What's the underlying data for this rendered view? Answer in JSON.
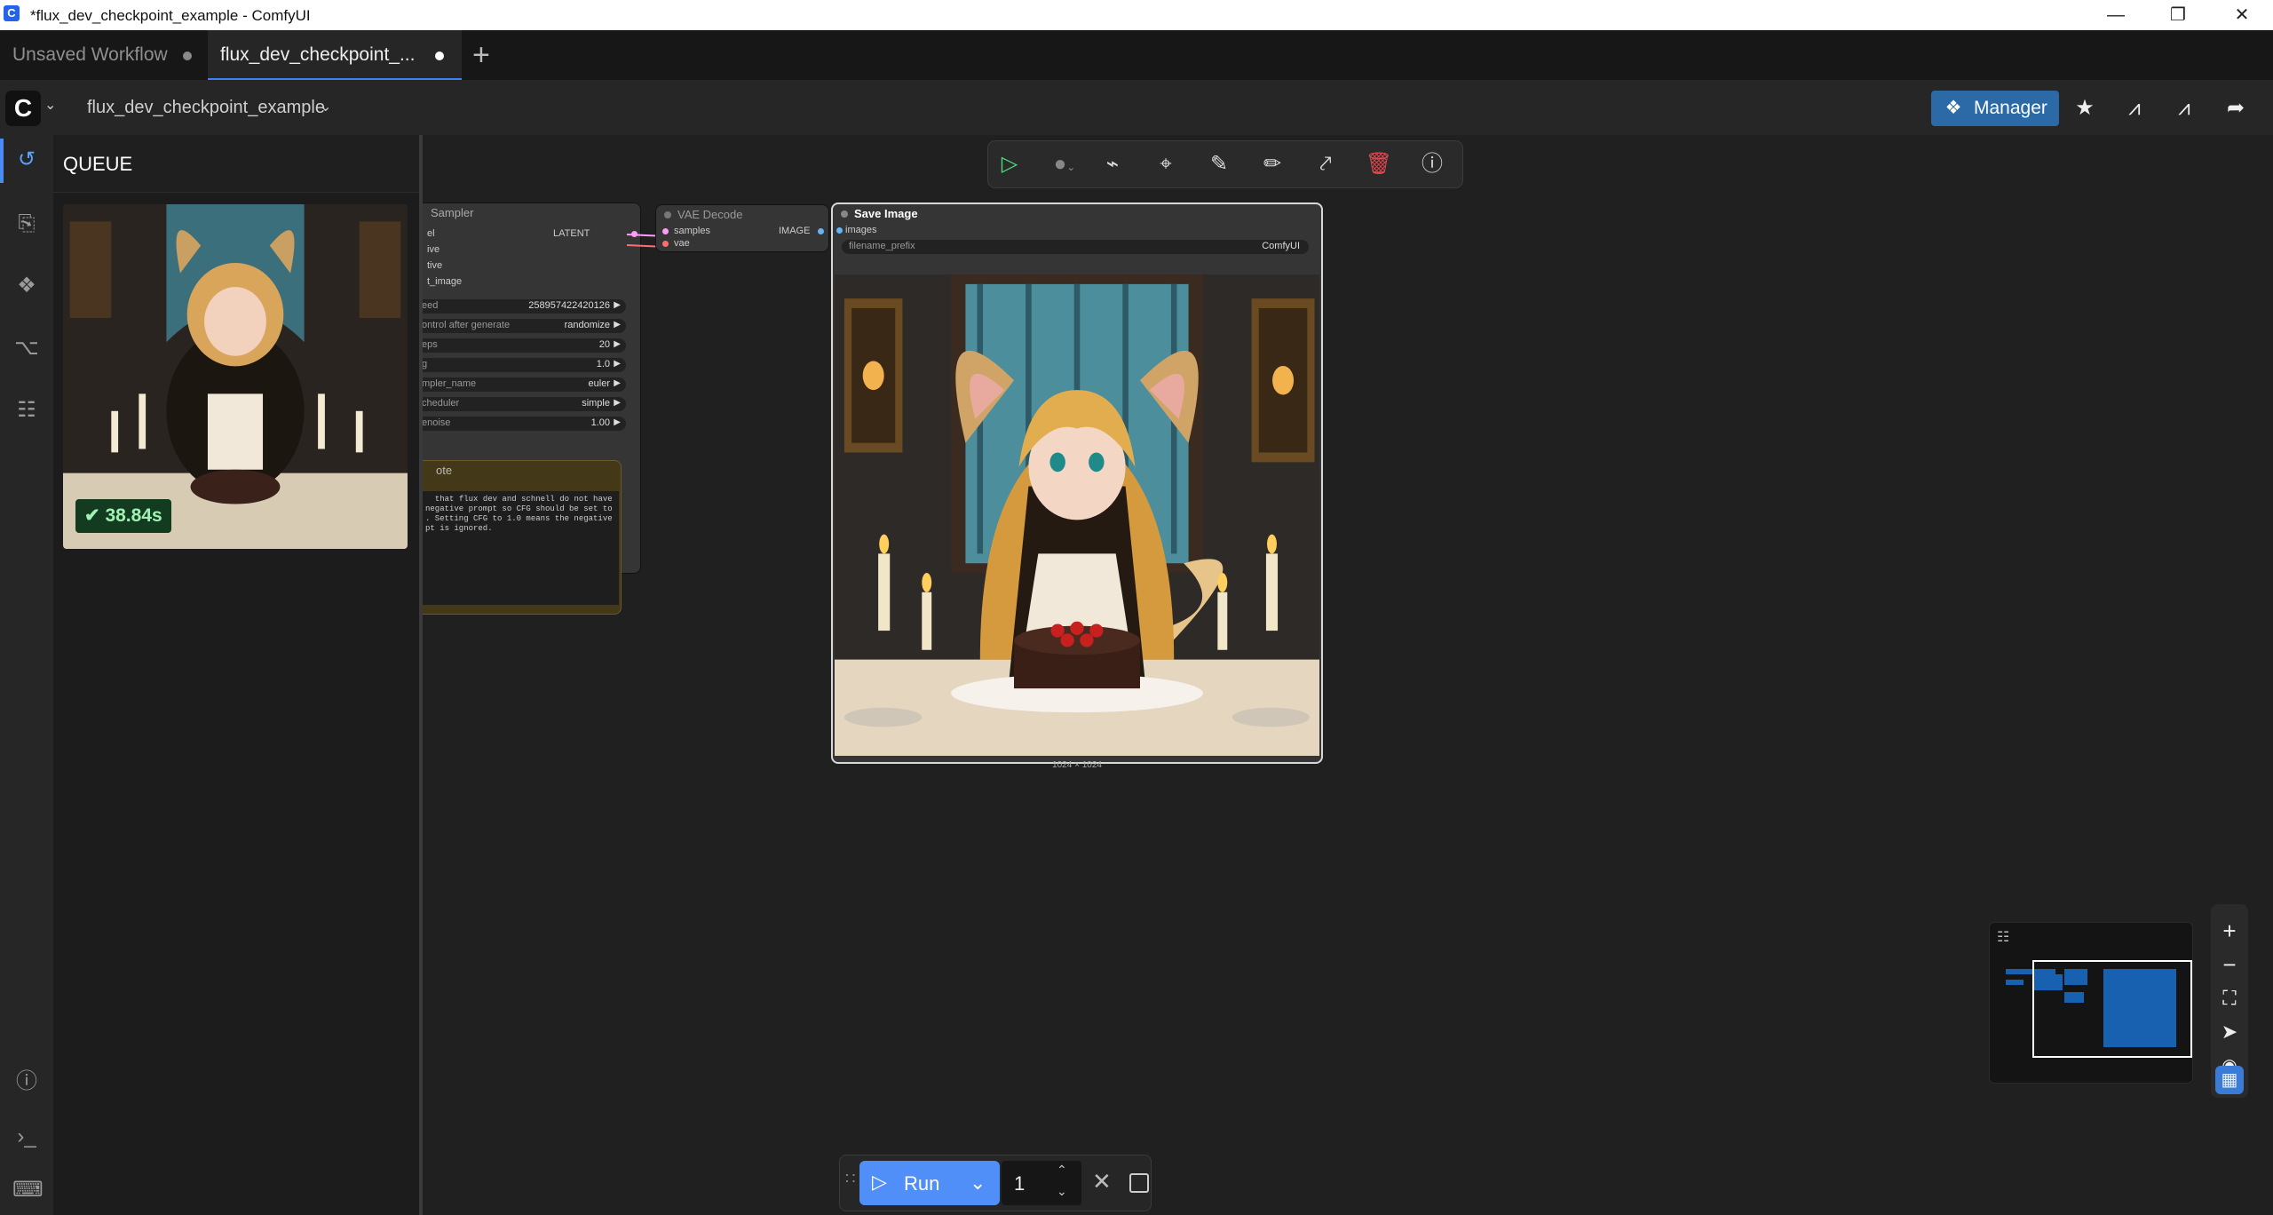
{
  "window": {
    "title": "*flux_dev_checkpoint_example - ComfyUI",
    "app_icon": "C",
    "controls": [
      "minimize-icon",
      "restore-icon",
      "close-icon"
    ]
  },
  "tabs": [
    {
      "label": "Unsaved Workflow",
      "modified_dot": "•"
    },
    {
      "label": "flux_dev_checkpoint_...",
      "modified_dot": "•",
      "active": true
    }
  ],
  "new_tab_label": "+",
  "menubar": {
    "logo": "C",
    "workflow_name": "flux_dev_checkpoint_example",
    "manager_label": "Manager",
    "right_icons": [
      "star-icon",
      "node-library-icon",
      "models-icon",
      "share-icon"
    ]
  },
  "sidebar": {
    "items": [
      "queue-history-icon",
      "node-library-icon",
      "model-library-icon",
      "workflows-icon",
      "templates-icon"
    ],
    "bottom_items": [
      "help-icon",
      "terminal-icon",
      "keyboard-icon"
    ]
  },
  "queue": {
    "title": "QUEUE",
    "item": {
      "status": "completed",
      "duration": "38.84s"
    }
  },
  "canvas": {
    "toolbar": [
      "queue-run-icon",
      "color-icon",
      "bypass-icon",
      "pin-icon",
      "edit-icon",
      "pencil-icon",
      "collapse-icon",
      "delete-icon",
      "help-icon"
    ],
    "nodes": {
      "ksampler": {
        "title": "Sampler",
        "output": "LATENT",
        "inputs": [
          "el",
          "ive",
          "tive",
          "t_image"
        ],
        "widgets": [
          {
            "label": "eed",
            "value": "258957422420126"
          },
          {
            "label": "ontrol after generate",
            "value": "randomize"
          },
          {
            "label": "eps",
            "value": "20"
          },
          {
            "label": "g",
            "value": "1.0"
          },
          {
            "label": "mpler_name",
            "value": "euler"
          },
          {
            "label": "cheduler",
            "value": "simple"
          },
          {
            "label": "enoise",
            "value": "1.00"
          }
        ]
      },
      "vae_decode": {
        "title": "VAE Decode",
        "inputs": [
          "samples",
          "vae"
        ],
        "output": "IMAGE"
      },
      "note": {
        "title": "ote",
        "text": "  that flux dev and schnell do not have\nnegative prompt so CFG should be set to\n. Setting CFG to 1.0 means the negative\npt is ignored."
      },
      "save_image": {
        "title": "Save Image",
        "input": "images",
        "widget_label": "filename_prefix",
        "widget_value": "ComfyUI",
        "image_size": "1024 × 1024"
      }
    }
  },
  "minimap": {
    "settings_icon": "sliders-icon"
  },
  "zoom_controls": [
    "zoom-in-icon",
    "zoom-out-icon",
    "fit-view-icon",
    "select-mode-icon",
    "visibility-icon",
    "minimap-icon"
  ],
  "runbar": {
    "run_label": "Run",
    "batch_count": "1"
  },
  "colors": {
    "accent": "#4f8ff7",
    "manager": "#2b6aa6",
    "success_text": "#9ff2b4",
    "delete": "#e5484d"
  }
}
